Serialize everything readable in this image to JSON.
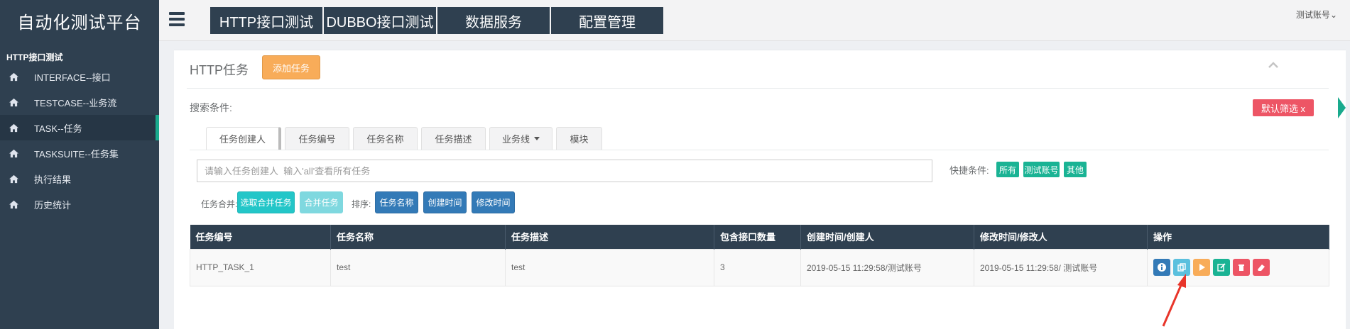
{
  "sidebar": {
    "brand": "自动化测试平台",
    "section": "HTTP接口测试",
    "items": [
      {
        "label": "INTERFACE--接口"
      },
      {
        "label": "TESTCASE--业务流"
      },
      {
        "label": "TASK--任务"
      },
      {
        "label": "TASKSUITE--任务集"
      },
      {
        "label": "执行结果"
      },
      {
        "label": "历史统计"
      }
    ]
  },
  "topbar": {
    "nav": [
      "HTTP接口测试",
      "DUBBO接口测试",
      "数据服务",
      "配置管理"
    ],
    "account": "测试账号"
  },
  "panel": {
    "title": "HTTP任务",
    "add_button": "添加任务",
    "search_label": "搜索条件:",
    "filter_badge": "默认筛选  x",
    "tabs": [
      "任务创建人",
      "任务编号",
      "任务名称",
      "任务描述",
      "业务线",
      "模块"
    ],
    "search_placeholder": "请输入任务创建人  输入'all'查看所有任务",
    "quick_label": "快捷条件:",
    "quick_tags": [
      "所有",
      "测试账号",
      "其他"
    ],
    "merge_label": "任务合并:",
    "merge_buttons": [
      "选取合并任务",
      "合并任务"
    ],
    "sort_label": "排序:",
    "sort_buttons": [
      "任务名称",
      "创建时间",
      "修改时间"
    ]
  },
  "table": {
    "headers": [
      "任务编号",
      "任务名称",
      "任务描述",
      "包含接口数量",
      "创建时间/创建人",
      "修改时间/修改人",
      "操作"
    ],
    "rows": [
      [
        "HTTP_TASK_1",
        "test",
        "test",
        "3",
        "2019-05-15 11:29:58/测试账号",
        "2019-05-15 11:29:58/ 测试账号"
      ]
    ]
  },
  "colors": {
    "sidebar_bg": "#2f4050",
    "accent_green": "#19aa8d",
    "warning": "#f8ac59",
    "danger": "#ed5565",
    "primary": "#337ab7",
    "info": "#23c6c8"
  }
}
